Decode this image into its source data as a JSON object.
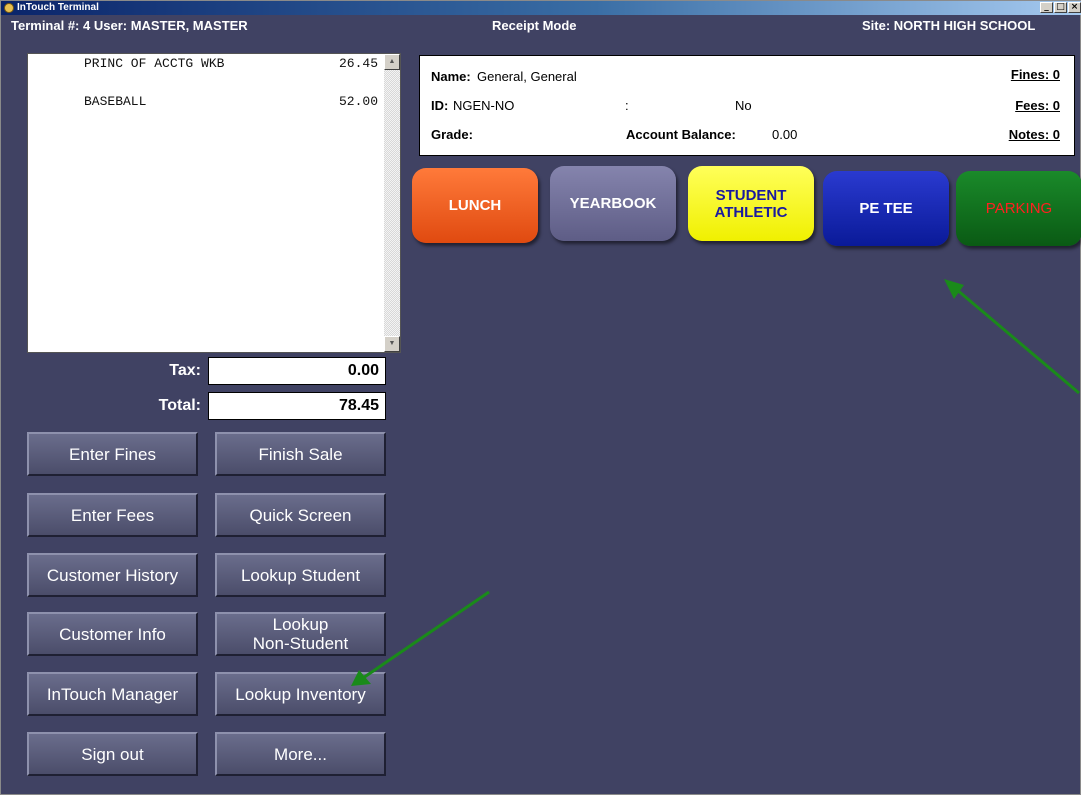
{
  "window": {
    "title": "InTouch Terminal"
  },
  "status": {
    "terminal_user": "Terminal #: 4   User: MASTER, MASTER",
    "mode": "Receipt Mode",
    "site": "Site: NORTH HIGH SCHOOL"
  },
  "receipt": {
    "items": [
      {
        "description": "PRINC OF ACCTG WKB",
        "amount": "26.45"
      },
      {
        "description": "BASEBALL",
        "amount": "52.00"
      }
    ]
  },
  "totals": {
    "tax_label": "Tax:",
    "tax_value": "0.00",
    "total_label": "Total:",
    "total_value": "78.45"
  },
  "actions": {
    "enter_fines": "Enter Fines",
    "finish_sale": "Finish Sale",
    "enter_fees": "Enter Fees",
    "quick_screen": "Quick Screen",
    "customer_history": "Customer History",
    "lookup_student": "Lookup Student",
    "customer_info": "Customer Info",
    "lookup_non_student_1": "Lookup",
    "lookup_non_student_2": "Non-Student",
    "intouch_manager": "InTouch Manager",
    "lookup_inventory": "Lookup Inventory",
    "sign_out": "Sign out",
    "more": "More..."
  },
  "customer": {
    "name_label": "Name:",
    "name_value": "General, General",
    "id_label": "ID:",
    "id_value": "NGEN-NO",
    "colon": ":",
    "no_value": "No",
    "grade_label": "Grade:",
    "balance_label": "Account Balance:",
    "balance_value": "0.00",
    "fines": "Fines: 0",
    "fees": "Fees: 0",
    "notes": "Notes: 0"
  },
  "categories": {
    "lunch": "LUNCH",
    "yearbook": "YEARBOOK",
    "student_athletic_1": "STUDENT",
    "student_athletic_2": "ATHLETIC",
    "pe_tee": "PE TEE",
    "parking": "PARKING"
  },
  "colors": {
    "background": "#404263",
    "lunch": "#f05a1a",
    "yearbook": "#6b6a93",
    "student_athletic": "#ffff1a",
    "pe_tee": "#0a1aa8",
    "parking": "#0d6a1a",
    "parking_text": "#ff1a1a",
    "annotation_arrow": "#1a8a1a"
  }
}
